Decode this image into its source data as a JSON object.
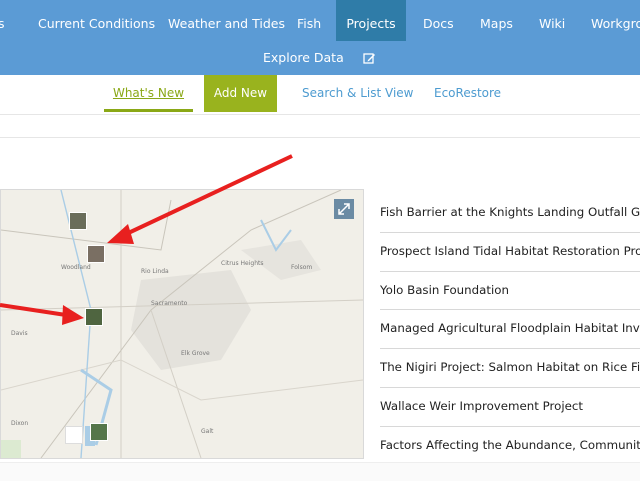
{
  "nav": {
    "items": [
      {
        "label": "s"
      },
      {
        "label": "Current Conditions"
      },
      {
        "label": "Weather and Tides"
      },
      {
        "label": "Fish"
      },
      {
        "label": "Projects"
      },
      {
        "label": "Docs"
      },
      {
        "label": "Maps"
      },
      {
        "label": "Wiki"
      },
      {
        "label": "Workgrou"
      }
    ],
    "explore_label": "Explore Data",
    "edit_icon": "edit-icon"
  },
  "subnav": {
    "whats_new": "What's New",
    "add_new": "Add New",
    "search_list": "Search & List View",
    "ecorestore": "EcoRestore"
  },
  "map": {
    "labels": [
      "Woodland",
      "Rio Linda",
      "Sacramento",
      "Elk Grove",
      "Davis",
      "Dixon",
      "Citrus Heights",
      "Folsom",
      "Galt"
    ],
    "expand_icon": "expand-icon"
  },
  "projects": [
    "Fish Barrier at the Knights Landing Outfall Gates",
    "Prospect Island Tidal Habitat Restoration Project",
    "Yolo Basin Foundation",
    "Managed Agricultural Floodplain Habitat Investiga",
    "The Nigiri Project: Salmon Habitat on Rice Fields",
    "Wallace Weir Improvement Project",
    "Factors Affecting the Abundance, Community Com"
  ],
  "colors": {
    "nav_bg": "#5b9bd5",
    "nav_active": "#2f7ca8",
    "green_accent": "#99b31e",
    "link_blue": "#4d9bd0",
    "arrow_red": "#e8201f"
  }
}
